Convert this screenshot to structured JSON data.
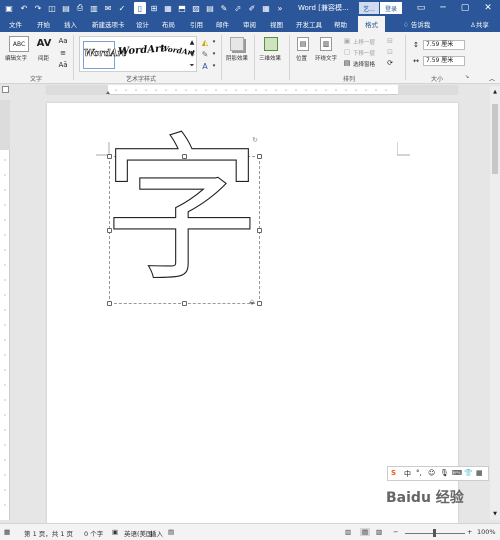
{
  "titlebar": {
    "doc_title": "Word [兼容模...",
    "sign_label": "艺...",
    "login_label": "登录",
    "minimize_icon": "minimize-icon",
    "restore_icon": "restore-icon",
    "close_icon": "close-icon"
  },
  "tabs": [
    {
      "label": "文件"
    },
    {
      "label": "开始"
    },
    {
      "label": "插入"
    },
    {
      "label": "新建选项卡"
    },
    {
      "label": "设计"
    },
    {
      "label": "布局"
    },
    {
      "label": "引用"
    },
    {
      "label": "邮件"
    },
    {
      "label": "审阅"
    },
    {
      "label": "视图"
    },
    {
      "label": "开发工具"
    },
    {
      "label": "帮助"
    },
    {
      "label": "格式"
    }
  ],
  "tell_me": "告诉我",
  "share": "共享",
  "ribbon": {
    "edit_text": "编辑文字",
    "spacing": "间距",
    "group_text": "文字",
    "wordart_samples": [
      "WordArt",
      "WordArt",
      "WordArt"
    ],
    "group_wordart": "艺术字样式",
    "shadow_effects": "阴影效果",
    "threed_effects": "三维效果",
    "position": "位置",
    "wrap_text": "环绕文字",
    "bring_forward": "上移一层",
    "send_backward": "下移一层",
    "selection_pane": "选择窗格",
    "group_arrange": "排列",
    "height_value": "7.59 厘米",
    "width_value": "7.59 厘米",
    "group_size": "大小"
  },
  "document": {
    "wordart_char": "字"
  },
  "ime": {
    "logo": "S",
    "mode": "中",
    "items": [
      "°,",
      "☺",
      "🎙",
      "⌨",
      "👕",
      "▦"
    ]
  },
  "watermark": "Baidu 经验",
  "status": {
    "page_info": "第 1 页，共 1 页",
    "word_count": "0 个字",
    "language": "英语(美国)",
    "mode": "插入",
    "zoom": "100%"
  },
  "colors": {
    "accent": "#2b579a",
    "ribbon_bg": "#f3f3f3",
    "canvas_bg": "#e6e6e6"
  }
}
